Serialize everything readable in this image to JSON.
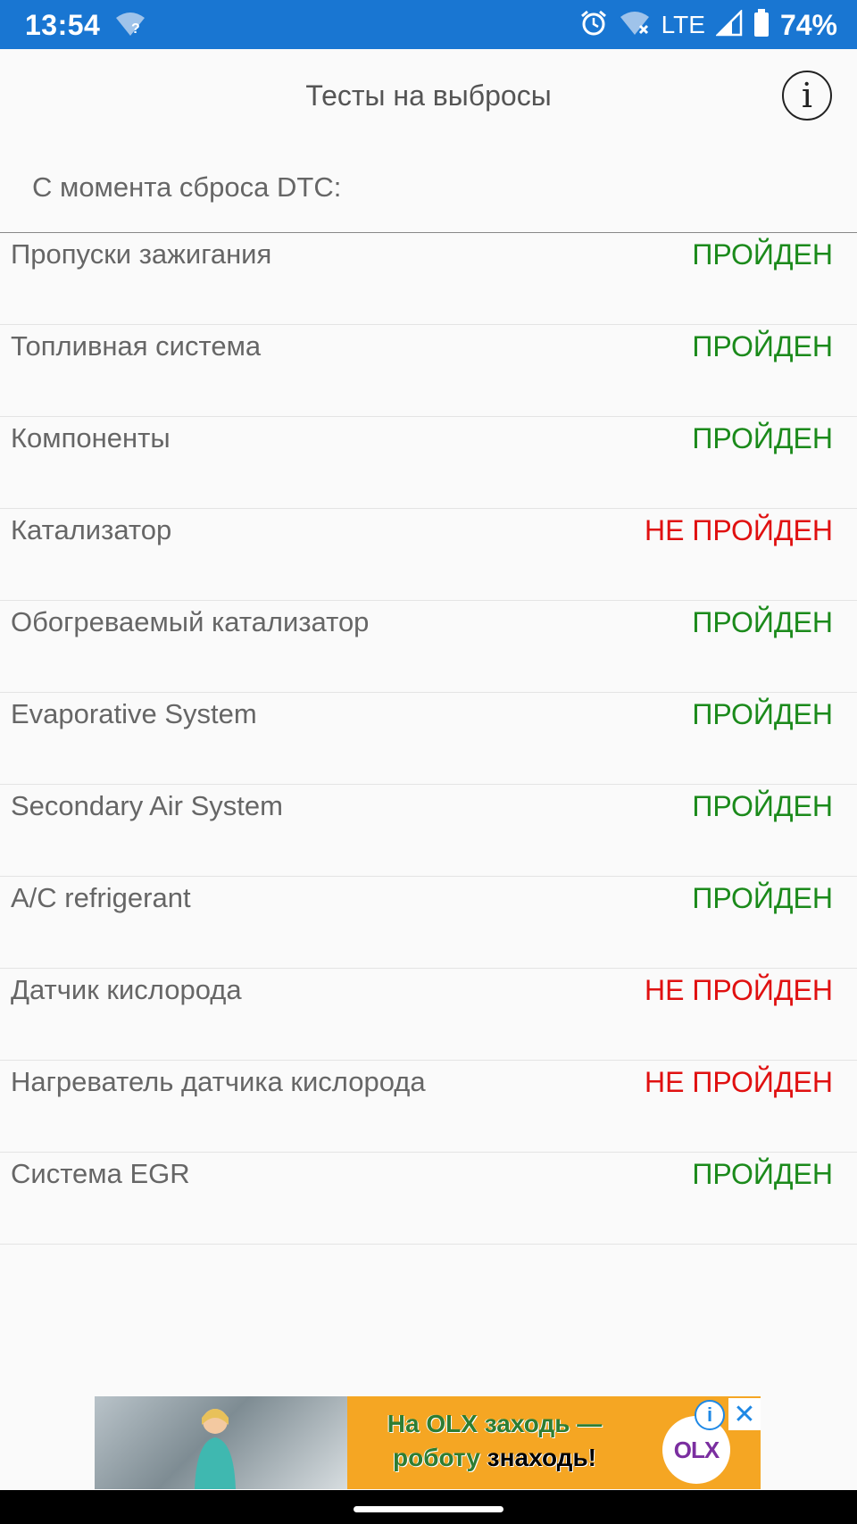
{
  "status_bar": {
    "time": "13:54",
    "network": "LTE",
    "battery": "74%",
    "icons": [
      "wifi-question-icon",
      "alarm-icon",
      "wifi-off-icon",
      "signal-icon",
      "battery-icon"
    ],
    "background": "#1976d2"
  },
  "header": {
    "title": "Тесты на выбросы",
    "info_label": "i"
  },
  "since_label": "С момента сброса DTC:",
  "status_colors": {
    "passed": "#1b8a1b",
    "failed": "#e01010"
  },
  "tests": [
    {
      "name": "Пропуски зажигания",
      "status": "ПРОЙДЕН",
      "state": "passed"
    },
    {
      "name": "Топливная система",
      "status": "ПРОЙДЕН",
      "state": "passed"
    },
    {
      "name": "Компоненты",
      "status": "ПРОЙДЕН",
      "state": "passed"
    },
    {
      "name": "Катализатор",
      "status": "НЕ ПРОЙДЕН",
      "state": "failed"
    },
    {
      "name": "Обогреваемый катализатор",
      "status": "ПРОЙДЕН",
      "state": "passed"
    },
    {
      "name": "Evaporative System",
      "status": "ПРОЙДЕН",
      "state": "passed"
    },
    {
      "name": "Secondary Air System",
      "status": "ПРОЙДЕН",
      "state": "passed"
    },
    {
      "name": "A/C refrigerant",
      "status": "ПРОЙДЕН",
      "state": "passed"
    },
    {
      "name": "Датчик кислорода",
      "status": "НЕ ПРОЙДЕН",
      "state": "failed"
    },
    {
      "name": "Нагреватель датчика кислорода",
      "status": "НЕ ПРОЙДЕН",
      "state": "failed"
    },
    {
      "name": "Система EGR",
      "status": "ПРОЙДЕН",
      "state": "passed"
    }
  ],
  "ad": {
    "line1": "На OLX заходь —",
    "line2_green": "роботу",
    "line2_dark": "знаходь!",
    "logo": "OLX",
    "info_label": "i",
    "close_label": "✕"
  }
}
